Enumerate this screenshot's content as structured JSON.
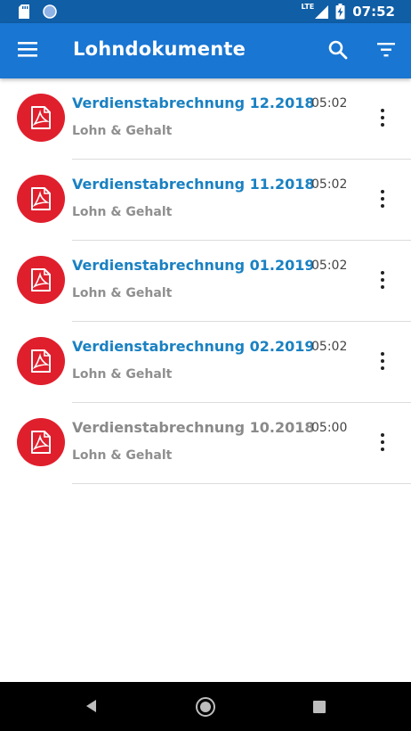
{
  "status_bar": {
    "time": "07:52",
    "network_label": "LTE",
    "icons": [
      "sd-card-icon",
      "sync-circle-icon",
      "signal-icon",
      "battery-charging-icon"
    ]
  },
  "app_bar": {
    "title": "Lohndokumente",
    "icons": [
      "menu-icon",
      "search-icon",
      "filter-icon"
    ]
  },
  "documents": [
    {
      "title": "Verdienstabrechnung 12.2018",
      "category": "Lohn & Gehalt",
      "time": "05:02",
      "read": false
    },
    {
      "title": "Verdienstabrechnung 11.2018",
      "category": "Lohn & Gehalt",
      "time": "05:02",
      "read": false
    },
    {
      "title": "Verdienstabrechnung 01.2019",
      "category": "Lohn & Gehalt",
      "time": "05:02",
      "read": false
    },
    {
      "title": "Verdienstabrechnung 02.2019",
      "category": "Lohn & Gehalt",
      "time": "05:02",
      "read": false
    },
    {
      "title": "Verdienstabrechnung 10.2018",
      "category": "Lohn & Gehalt",
      "time": "05:00",
      "read": true
    }
  ],
  "colors": {
    "status_bar": "#0f5ea6",
    "app_bar": "#1976d2",
    "unread_title": "#1a81c2",
    "read_title": "#8a8a8a",
    "pdf_badge": "#e01f2d",
    "nav_bar": "#000000"
  },
  "nav_bar": {
    "icons": [
      "back-icon",
      "home-icon",
      "recents-icon"
    ]
  }
}
